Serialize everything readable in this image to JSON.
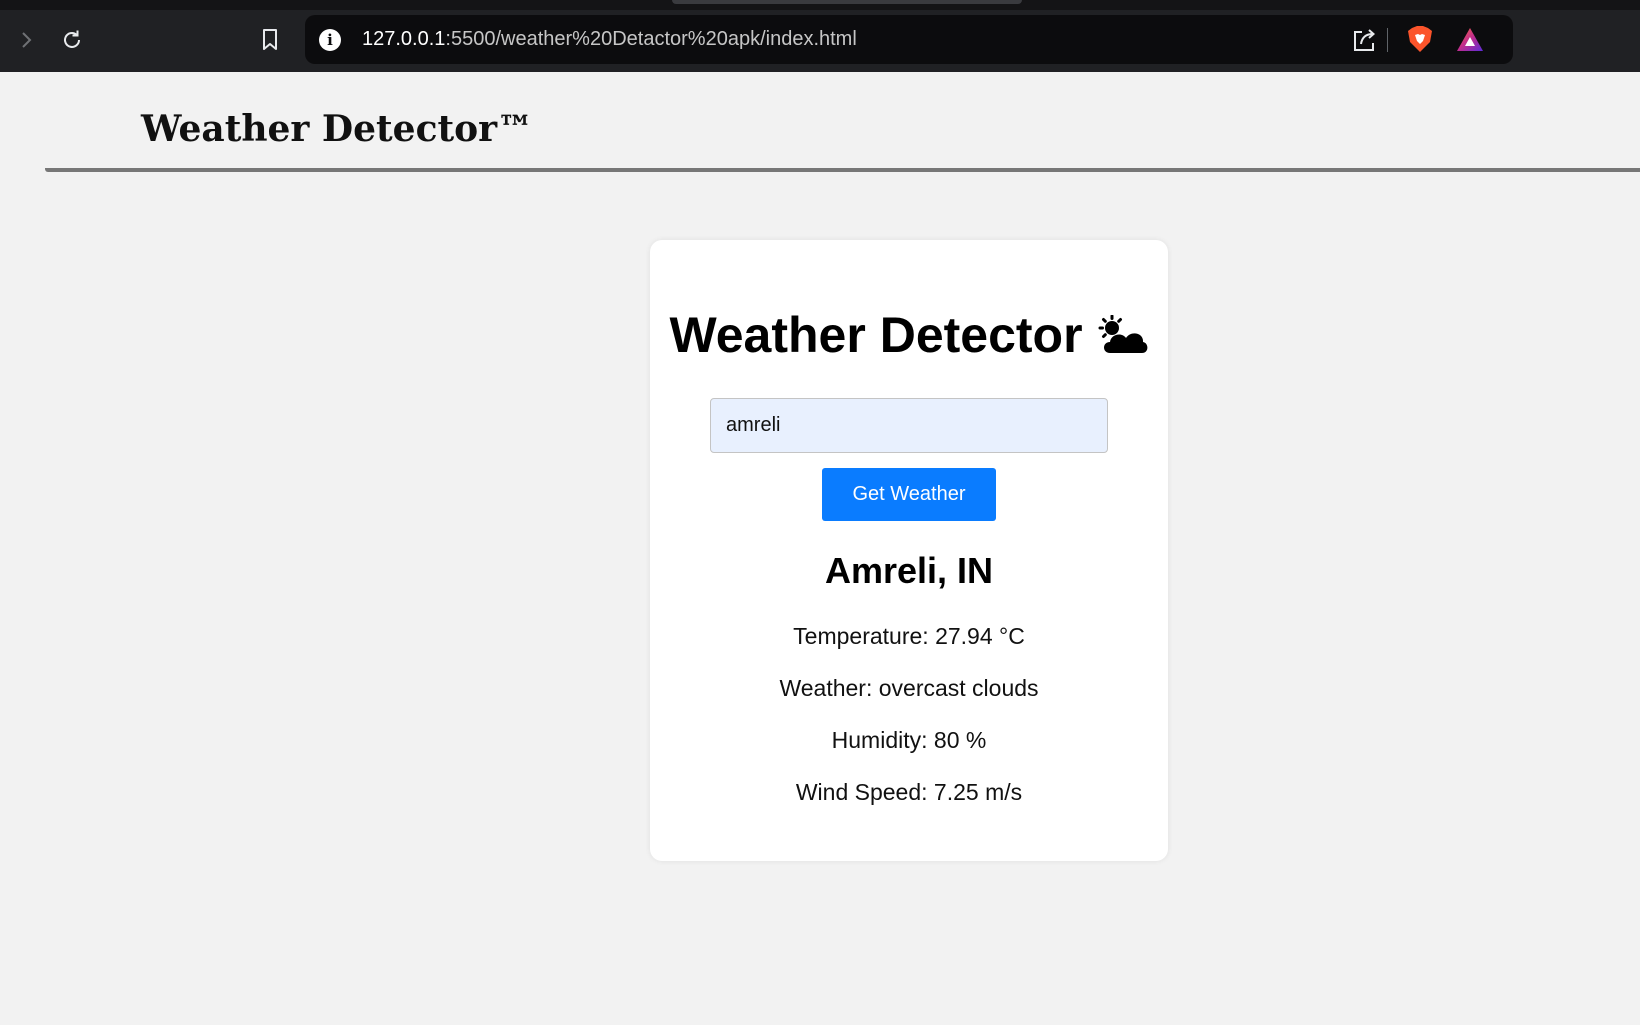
{
  "browser": {
    "url_host": "127.0.0.1",
    "url_path": ":5500/weather%20Detactor%20apk/index.html",
    "icons": [
      "forward-icon",
      "reload-icon",
      "bookmark-icon",
      "site-info-icon",
      "share-icon",
      "brave-shield-icon",
      "brave-rewards-icon"
    ]
  },
  "header": {
    "title": "Weather Detector™"
  },
  "card": {
    "title": "Weather Detector",
    "title_icon": "sun-behind-cloud-icon",
    "input": {
      "value": "amreli",
      "placeholder": ""
    },
    "button_label": "Get Weather",
    "result": {
      "city": "Amreli, IN",
      "temperature": "Temperature: 27.94 °C",
      "weather": "Weather: overcast clouds",
      "humidity": "Humidity: 80 %",
      "wind": "Wind Speed: 7.25 m/s"
    }
  },
  "colors": {
    "page_background": "#f2f2f2",
    "browser_chrome": "#202124",
    "button_primary": "#0a7cff",
    "input_background": "#e8f0fe",
    "card_background": "#ffffff"
  }
}
